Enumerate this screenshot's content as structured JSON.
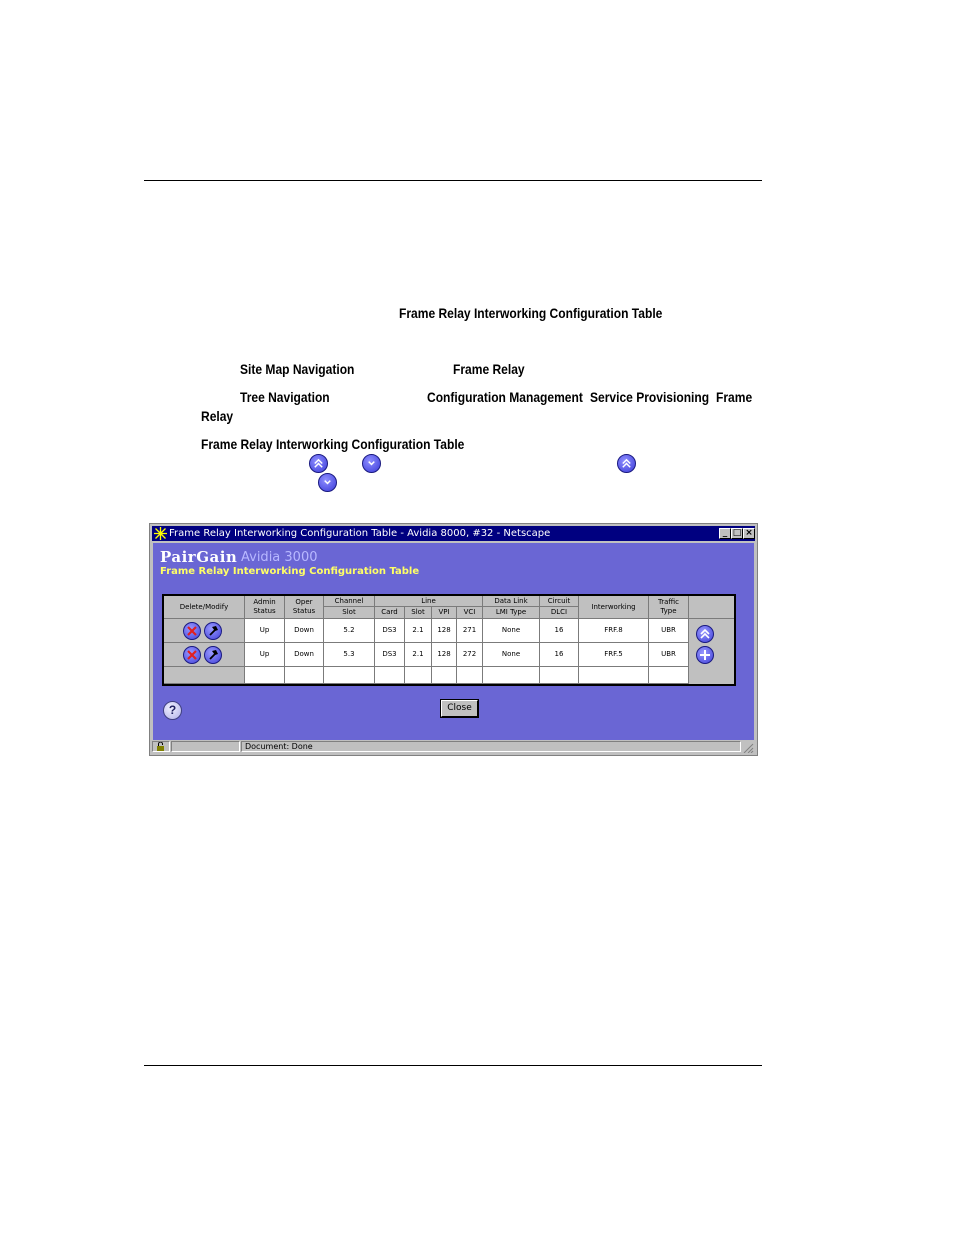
{
  "document": {
    "intro_ref": "Frame Relay Interworking Configuration Table",
    "site_map_label": "Site Map Navigation",
    "site_map_target": "Frame Relay",
    "tree_label": "Tree Navigation",
    "tree_path_1": "Configuration Management",
    "tree_path_2": "Service Provisioning",
    "tree_path_3": "Frame",
    "tree_path_4": "Relay",
    "table_ref": "Frame Relay Interworking Configuration Table"
  },
  "window": {
    "title": "Frame Relay Interworking Configuration Table - Avidia 8000, #32 - Netscape",
    "brand": "PairGain",
    "product": "Avidia 3000",
    "subtitle": "Frame Relay Interworking Configuration Table",
    "close_label": "Close",
    "help_label": "?",
    "status_text": "Document: Done"
  },
  "table": {
    "headers": {
      "delete_modify": "Delete/Modify",
      "admin_status": "Admin Status",
      "oper_status": "Oper Status",
      "channel": "Channel",
      "channel_slot": "Slot",
      "line": "Line",
      "line_card": "Card",
      "line_slot": "Slot",
      "line_vpi": "VPI",
      "line_vci": "VCI",
      "data_link": "Data Link",
      "lmi_type": "LMI Type",
      "circuit": "Circuit",
      "dlci": "DLCI",
      "interworking": "Interworking",
      "traffic_type": "Traffic Type"
    },
    "rows": [
      {
        "admin": "Up",
        "oper": "Down",
        "channel_slot": "5.2",
        "card": "DS3",
        "line_slot": "2.1",
        "vpi": "128",
        "vci": "271",
        "lmi": "None",
        "dlci": "16",
        "interworking": "FRF.8",
        "traffic": "UBR"
      },
      {
        "admin": "Up",
        "oper": "Down",
        "channel_slot": "5.3",
        "card": "DS3",
        "line_slot": "2.1",
        "vpi": "128",
        "vci": "272",
        "lmi": "None",
        "dlci": "16",
        "interworking": "FRF.5",
        "traffic": "UBR"
      }
    ]
  },
  "colors": {
    "content_bg": "#6a66d4",
    "title_bar": "#000080",
    "subtitle": "#ffff66"
  }
}
